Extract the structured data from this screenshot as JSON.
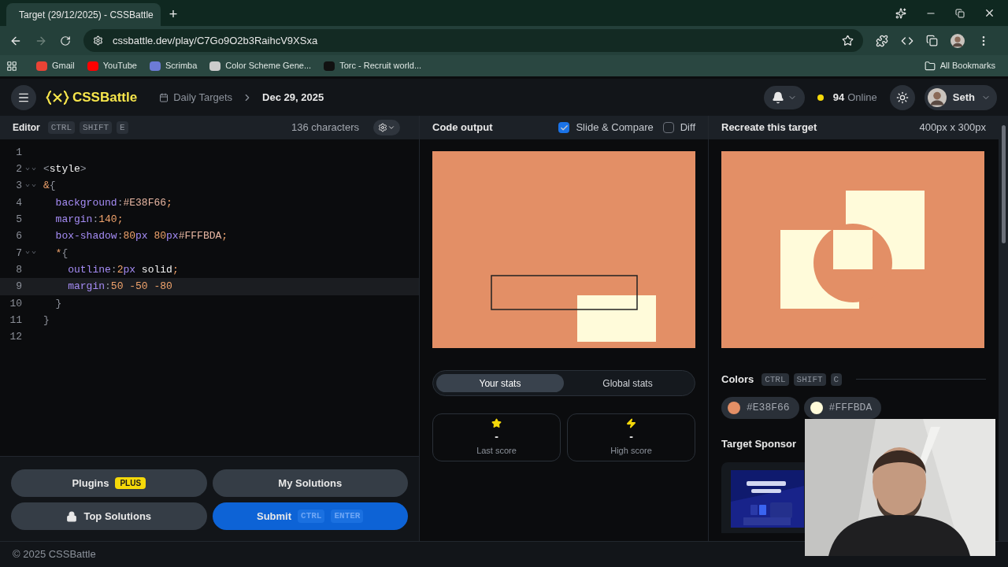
{
  "browser": {
    "tab_title": "Target (29/12/2025) - CSSBattle",
    "new_tab": "+",
    "url": "cssbattle.dev/play/C7Go9O2b3RaihcV9XSxa",
    "bookmarks": [
      {
        "label": "Gmail"
      },
      {
        "label": "YouTube"
      },
      {
        "label": "Scrimba"
      },
      {
        "label": "Color Scheme Gene..."
      },
      {
        "label": "Torc - Recruit world..."
      }
    ],
    "all_bookmarks": "All Bookmarks"
  },
  "header": {
    "logo": "CSSBattle",
    "breadcrumb": [
      "Daily Targets",
      "Dec 29, 2025"
    ],
    "online_count": "94",
    "online_label": "Online",
    "user": "Seth"
  },
  "editor": {
    "title": "Editor",
    "keys": [
      "CTRL",
      "SHIFT",
      "E"
    ],
    "char_count": "136 characters",
    "lines": [
      {
        "number": "1",
        "fold": false,
        "current": false
      },
      {
        "number": "2",
        "fold": true,
        "current": false,
        "tokens": [
          {
            "kind": "punct",
            "text": "<"
          },
          {
            "kind": "tag",
            "text": "style"
          },
          {
            "kind": "punct",
            "text": ">"
          }
        ]
      },
      {
        "number": "3",
        "fold": true,
        "current": false,
        "tokens": [
          {
            "kind": "num",
            "text": "&"
          },
          {
            "kind": "punct",
            "text": "{"
          }
        ]
      },
      {
        "number": "4",
        "fold": false,
        "current": false,
        "tokens": [
          {
            "kind": "prop",
            "text": "  background"
          },
          {
            "kind": "punct",
            "text": ":"
          },
          {
            "kind": "hex",
            "text": "#E38F66"
          },
          {
            "kind": "num",
            "text": ";"
          }
        ]
      },
      {
        "number": "5",
        "fold": false,
        "current": false,
        "tokens": [
          {
            "kind": "prop",
            "text": "  margin"
          },
          {
            "kind": "punct",
            "text": ":"
          },
          {
            "kind": "num",
            "text": "140;"
          }
        ]
      },
      {
        "number": "6",
        "fold": false,
        "current": false,
        "tokens": [
          {
            "kind": "prop",
            "text": "  box-shadow"
          },
          {
            "kind": "punct",
            "text": ":"
          },
          {
            "kind": "num",
            "text": "80"
          },
          {
            "kind": "prop",
            "text": "px "
          },
          {
            "kind": "num",
            "text": "80"
          },
          {
            "kind": "prop",
            "text": "px"
          },
          {
            "kind": "hex",
            "text": "#FFFBDA"
          },
          {
            "kind": "num",
            "text": ";"
          }
        ]
      },
      {
        "number": "7",
        "fold": true,
        "current": false,
        "tokens": [
          {
            "kind": "num",
            "text": "  *"
          },
          {
            "kind": "punct",
            "text": "{"
          }
        ]
      },
      {
        "number": "8",
        "fold": false,
        "current": false,
        "tokens": [
          {
            "kind": "prop",
            "text": "    outline"
          },
          {
            "kind": "punct",
            "text": ":"
          },
          {
            "kind": "num",
            "text": "2"
          },
          {
            "kind": "prop",
            "text": "px "
          },
          {
            "kind": "tag",
            "text": "solid"
          },
          {
            "kind": "num",
            "text": ";"
          }
        ]
      },
      {
        "number": "9",
        "fold": false,
        "current": true,
        "tokens": [
          {
            "kind": "prop",
            "text": "    margin"
          },
          {
            "kind": "punct",
            "text": ":"
          },
          {
            "kind": "num",
            "text": "50 -50 -80"
          }
        ]
      },
      {
        "number": "10",
        "fold": false,
        "current": false,
        "tokens": [
          {
            "kind": "punct",
            "text": "  }"
          }
        ]
      },
      {
        "number": "11",
        "fold": false,
        "current": false,
        "tokens": [
          {
            "kind": "punct",
            "text": "}"
          }
        ]
      },
      {
        "number": "12",
        "fold": false,
        "current": false
      }
    ]
  },
  "output": {
    "title": "Code output",
    "options": [
      {
        "label": "Slide & Compare",
        "checked": true
      },
      {
        "label": "Diff",
        "checked": false
      }
    ]
  },
  "stats": {
    "tabs": [
      {
        "label": "Your stats",
        "selected": true
      },
      {
        "label": "Global stats",
        "selected": false
      }
    ],
    "cards": [
      {
        "kind": "star",
        "value": "-",
        "label": "Last score"
      },
      {
        "kind": "bolt",
        "value": "-",
        "label": "High score"
      }
    ]
  },
  "target": {
    "title": "Recreate this target",
    "size": "400px x 300px",
    "colors_title": "Colors",
    "keys": [
      "CTRL",
      "SHIFT",
      "C"
    ],
    "colors": [
      {
        "hex": "#E38F66",
        "color": "#e38f66"
      },
      {
        "hex": "#FFFBDA",
        "color": "#fffbda"
      }
    ],
    "sponsor_title": "Target Sponsor"
  },
  "buttons": [
    {
      "kind": "secondary",
      "label": "Plugins",
      "badge": "PLUS",
      "locked": false
    },
    {
      "kind": "secondary",
      "label": "My Solutions",
      "locked": false
    },
    {
      "kind": "secondary",
      "label": "Top Solutions",
      "locked": true
    },
    {
      "kind": "primary",
      "label": "Submit",
      "locked": false,
      "keys": [
        "CTRL",
        "ENTER"
      ]
    }
  ],
  "footer": "© 2025 CSSBattle"
}
